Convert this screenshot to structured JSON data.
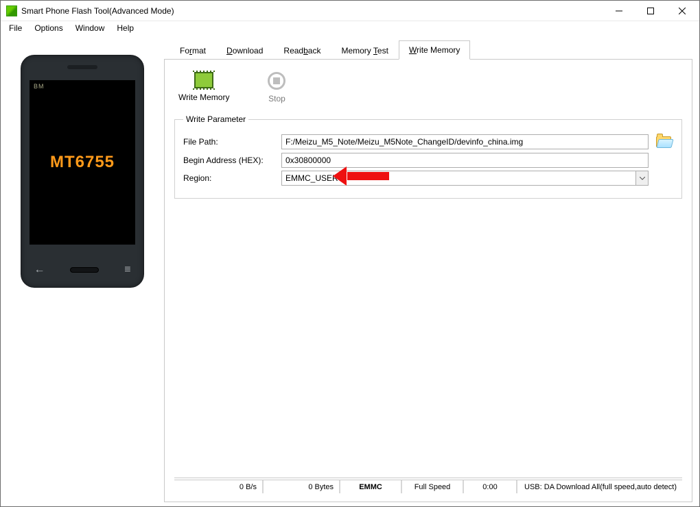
{
  "window": {
    "title": "Smart Phone Flash Tool(Advanced Mode)"
  },
  "menu": {
    "file": "File",
    "options": "Options",
    "window": "Window",
    "help": "Help"
  },
  "phone": {
    "brand": "BM",
    "chipset": "MT6755"
  },
  "tabs": {
    "format_pre": "Fo",
    "format_hot": "r",
    "format_post": "mat",
    "download_hot": "D",
    "download_post": "ownload",
    "readback_pre": "Read",
    "readback_hot": "b",
    "readback_post": "ack",
    "memtest_pre": "Memory ",
    "memtest_hot": "T",
    "memtest_post": "est",
    "writemem_hot": "W",
    "writemem_post": "rite Memory"
  },
  "toolbar": {
    "write_memory": "Write Memory",
    "stop": "Stop"
  },
  "param": {
    "legend": "Write Parameter",
    "file_path_label": "File Path:",
    "file_path_value": "F:/Meizu_M5_Note/Meizu_M5Note_ChangeID/devinfo_china.img",
    "begin_addr_label": "Begin Address (HEX):",
    "begin_addr_value": "0x30800000",
    "region_label": "Region:",
    "region_value": "EMMC_USER"
  },
  "status": {
    "speed": "0 B/s",
    "bytes": "0 Bytes",
    "storage": "EMMC",
    "link": "Full Speed",
    "time": "0:00",
    "usb": "USB: DA Download All(full speed,auto detect)"
  }
}
